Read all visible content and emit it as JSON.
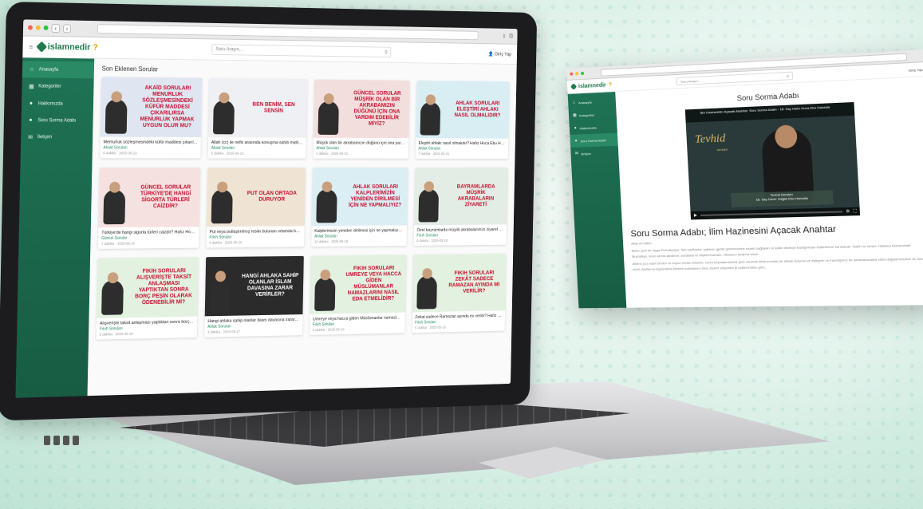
{
  "colors": {
    "brand": "#1f7a4d",
    "accent_red": "#c8102e",
    "sidebar": "#1f7355"
  },
  "laptop": {
    "site": {
      "logo": "islamnedir",
      "logo_mark": "?",
      "search_placeholder": "Soru Arayın...",
      "login": "Giriş Yap"
    },
    "sidebar": [
      {
        "icon": "home-icon",
        "glyph": "⌂",
        "label": "Anasayfa",
        "active": true
      },
      {
        "icon": "grid-icon",
        "glyph": "▦",
        "label": "Kategoriler",
        "active": false
      },
      {
        "icon": "info-icon",
        "glyph": "●",
        "label": "Hakkımızda",
        "active": false
      },
      {
        "icon": "question-icon",
        "glyph": "●",
        "label": "Soru Sorma Adabı",
        "active": false
      },
      {
        "icon": "mail-icon",
        "glyph": "✉",
        "label": "İletişim",
        "active": false
      }
    ],
    "section_title": "Son Eklenen Sorular",
    "cards": [
      {
        "caption": "AKAİD SORULARI MENURLUK SÖZLEŞMESİNDEKİ KÜFÜR MADDESİ ÇIKARILIRSA MENURLUK YAPMAK UYGUN OLUR MU?",
        "bg": "#dfe6f2",
        "title": "Memurluk sözleşmesindeki küfür maddesi çıkarıldı...",
        "cat": "Akaid Soruları",
        "meta": "8 dakika · 2025-05-23"
      },
      {
        "caption": "BEN BENİM, SEN SENSİN",
        "bg": "#eef0f3",
        "title": "Allah (cc) ile nefis arasında konuşma sahib midir?...",
        "cat": "Akaid Soruları",
        "meta": "5 dakika · 2025-05-23"
      },
      {
        "caption": "GÜNCEL SORULAR MÜŞRİK OLAN BİR AKRABAMIZIN DÜĞÜNÜ İÇİN ONA YARDIM EDEBİLİR MİYİZ?",
        "bg": "#f3dede",
        "title": "Müşrik olan bir akrabamızın düğünü için ona yardı...",
        "cat": "Ahlak Soruları",
        "meta": "4 dakika · 2025-05-21"
      },
      {
        "caption": "AHLAK SORULARI ELEŞTİRİ AHLAKI NASIL OLMALIDIR?",
        "bg": "#d9eef3",
        "title": "Eleştiri ahlakı nasıl olmalıdır? Hafız Hoca Ebu Hans...",
        "cat": "Ahlak Soruları",
        "meta": "7 dakika · 2025-05-21"
      },
      {
        "caption": "GÜNCEL SORULAR TÜRKİYE'DE HANGİ SİGORTA TÜRLERİ CAİZDİR?",
        "bg": "#f6e1e1",
        "title": "Türkiye'de hangi sigorta türleri caizdir? Hafız Hoca...",
        "cat": "Güncel Sorular",
        "meta": "7 dakika · 2025-05-20"
      },
      {
        "caption": "PUT OLAN ORTADA DURUYOR",
        "bg": "#efe3d4",
        "title": "Put veya putlaştırılmış resim bulunan ortamda bul...",
        "cat": "Fıkıh Soruları",
        "meta": "6 dakika · 2025-05-20"
      },
      {
        "caption": "AHLAK SORULARI KALPLERİMİZİN YENİDEN DİRİLMESİ İÇİN NE YAPMALIYIZ?",
        "bg": "#dbeef4",
        "title": "Kalplerimizin yeniden dirilmesi için ne yapmalıyız?...",
        "cat": "Ahlak Soruları",
        "meta": "10 dakika · 2025-05-19"
      },
      {
        "caption": "BAYRAMLARDA MÜŞRİK AKRABALARIN ZİYARETİ",
        "bg": "#e4ece6",
        "title": "Özel bayramlarda müşrik akrabalarımızı ziyaret et...",
        "cat": "Fıkıh Soruları",
        "meta": "9 dakika · 2025-05-18"
      },
      {
        "caption": "FIKIH SORULARI ALIŞVERİŞTE TAKSİT ANLAŞMASI YAPTIKTAN SONRA BORÇ PEŞİN OLARAK ÖDENEBİLİR Mİ?",
        "bg": "#e3f1e1",
        "title": "Alışverişte taksit anlaşması yaptıktan sonra borç p...",
        "cat": "Fıkıh Soruları",
        "meta": "5 dakika · 2025-05-18"
      },
      {
        "caption": "HANGİ AHLAKA SAHİP OLANLAR İSLAM DAVASINA ZARAR VERİRLER?",
        "bg": "#2b2b2b",
        "title": "Hangi ahlaka sahip olanlar İslam davasına zarar ve...",
        "cat": "Ahlak Soruları",
        "meta": "4 dakika · 2025-05-17"
      },
      {
        "caption": "FIKIH SORULARI UMREYE VEYA HACCA GİDEN MÜSLÜMANLAR NAMAZLARINI NASIL EDA ETMELİDİR?",
        "bg": "#e3f1e1",
        "title": "Umreye veya hacca giden Müslümanlar namazlarını n...",
        "cat": "Fıkıh Soruları",
        "meta": "6 dakika · 2025-05-16"
      },
      {
        "caption": "FIKIH SORULARI ZEKÂT SADECE RAMAZAN AYINDA MI VERİLİR?",
        "bg": "#e3f1e1",
        "title": "Zekat sadece Ramazan ayında mı verilir? Hafız Hoc...",
        "cat": "Fıkıh Soruları",
        "meta": "5 dakika · 2025-05-16"
      }
    ]
  },
  "window2": {
    "site": {
      "logo": "islamnedir",
      "logo_mark": "?",
      "search_placeholder": "Soru Arayın...",
      "login": "Giriş Yap"
    },
    "sidebar": [
      {
        "icon": "home-icon",
        "glyph": "⌂",
        "label": "Anasayfa",
        "active": false
      },
      {
        "icon": "grid-icon",
        "glyph": "▦",
        "label": "Kategoriler",
        "active": false
      },
      {
        "icon": "info-icon",
        "glyph": "●",
        "label": "Hakkımızda",
        "active": false
      },
      {
        "icon": "question-icon",
        "glyph": "●",
        "label": "Soru Sorma Adabı",
        "active": true
      },
      {
        "icon": "mail-icon",
        "glyph": "✉",
        "label": "İletişim",
        "active": false
      }
    ],
    "page_title": "Soru Sorma Adabı",
    "video": {
      "bar_title": "İlim Hazinesinin Açacak Anahtar: Soru Sorma Adabı - 18. Say Hafız Hoca Ebu Hanzala",
      "logo": "Tevhid",
      "logo_sub": "dersleri",
      "lower_name": "Tevhid Dersleri",
      "lower_line": "18. Say Dersi: Sağlık Ebu Hanzala"
    },
    "article_heading": "Soru Sorma Adabı; İlim Hazinesini Açacak Anahtar",
    "article_intro": "Allah'ım sabru",
    "article_p1": "Bütün yeni bir rayga Ruhullaniyla, 'İlim nazihadur' saflarını gerilik getirmelerine esaret sağlayan ve kalan dinimde kaldığımdan Kabirlerime karılılacak. Sabih ve selam, Hakiketi Muhammad Mustafaya, onun vanna ashabne, ashabina ve taşiklerinamam. Himarem tarafına olsun.",
    "article_p2": "Allah'a (cc) nasıl izinden ve kuyuz vicdan birisinin, sonrıl koşulaşmaranla göre okumak Allah'ımızdan ile ahkalı dolunun ve eşlegnin ve inandığımız bir sanıklanacaktır ettini değişlenmesine ve dava sözlü dostlarına kaydırıllıkla birbirim kalmalarını birer ziyaret ediyordur ki eşitlenenlere göre..."
  }
}
